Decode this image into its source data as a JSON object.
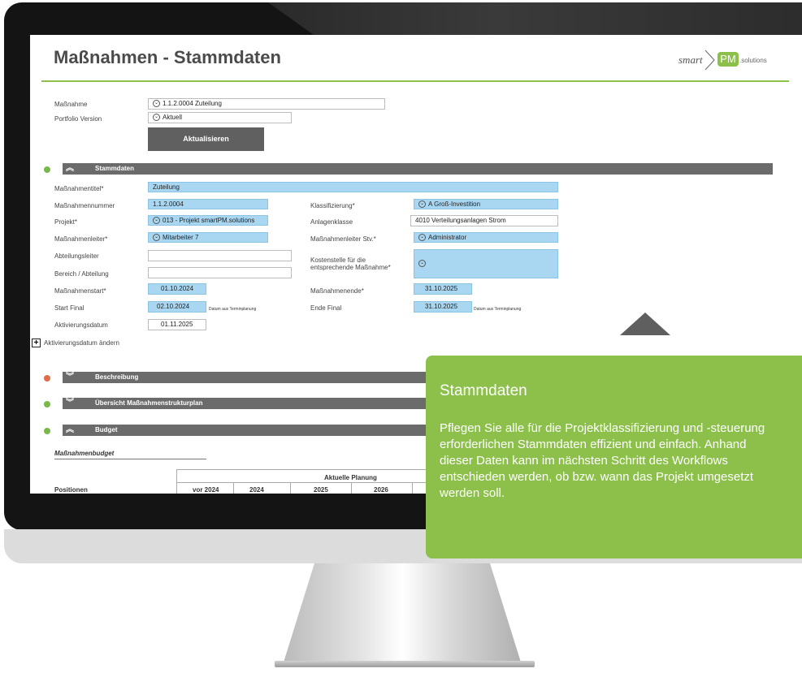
{
  "page": {
    "title": "Maßnahmen - Stammdaten"
  },
  "logo": {
    "smart": "smart",
    "pm": "PM",
    "solutions": ".solutions"
  },
  "top_form": {
    "massnahme_label": "Maßnahme",
    "massnahme_value": "1.1.2.0004 Zuteilung",
    "portfolio_label": "Portfolio Version",
    "portfolio_value": "Aktuell",
    "refresh_button": "Aktualisieren"
  },
  "sections": {
    "stammdaten": "Stammdaten",
    "beschreibung": "Beschreibung",
    "uebersicht": "Übersicht Maßnahmenstrukturplan",
    "budget": "Budget"
  },
  "fields": {
    "titel_label": "Maßnahmentitel*",
    "titel_value": "Zuteilung",
    "nummer_label": "Maßnahmennummer",
    "nummer_value": "1.1.2.0004",
    "projekt_label": "Projekt*",
    "projekt_value": "013 - Projekt smartPM.solutions",
    "leiter_label": "Maßnahmenleiter*",
    "leiter_value": "Mitarbeiter 7",
    "abteilungsleiter_label": "Abteilungsleiter",
    "bereich_label": "Bereich / Abteilung",
    "start_label": "Maßnahmenstart*",
    "start_value": "01.10.2024",
    "startfinal_label": "Start Final",
    "startfinal_value": "02.10.2024",
    "datum_hint": "Datum aus Terminplanung",
    "aktivierung_label": "Aktivierungsdatum",
    "aktivierung_value": "01.11.2025",
    "aktivierung_change": "Aktivierungsdatum ändern",
    "klass_label": "Klassifizierung*",
    "klass_value": "A Groß-Investition",
    "anlagen_label": "Anlagenklasse",
    "anlagen_value": "4010 Verteilungsanlagen Strom",
    "stv_label": "Maßnahmenleiter Stv.*",
    "stv_value": "Administrator",
    "kosten_label_1": "Kostenstelle für die",
    "kosten_label_2": "entsprechende Maßnahme*",
    "ende_label": "Maßnahmenende*",
    "ende_value": "31.10.2025",
    "endefinal_label": "Ende Final",
    "endefinal_value": "31.10.2025"
  },
  "budget": {
    "subtitle": "Maßnahmenbudget",
    "group_header": "Aktuelle Planung",
    "col_positionen": "Positionen",
    "col_vor2024": "vor 2024",
    "col_2024": "2024",
    "col_2025": "2025",
    "col_2026": "2026"
  },
  "tooltip": {
    "title": "Stammdaten",
    "line1": "Pflegen Sie alle für die Projektklassifizierung und -steuerung",
    "line2": "erforderlichen Stammdaten effizient und einfach. Anhand",
    "line3": "dieser Daten kann im nächsten Schritt des Workflows",
    "line4": "entschieden werden, ob bzw. wann das Projekt umgesetzt",
    "line5": "werden soll."
  },
  "colors": {
    "accent_green": "#8cc04b",
    "field_blue": "#a9d7f2",
    "status_green": "#79b84a",
    "status_red": "#e06b4a"
  }
}
